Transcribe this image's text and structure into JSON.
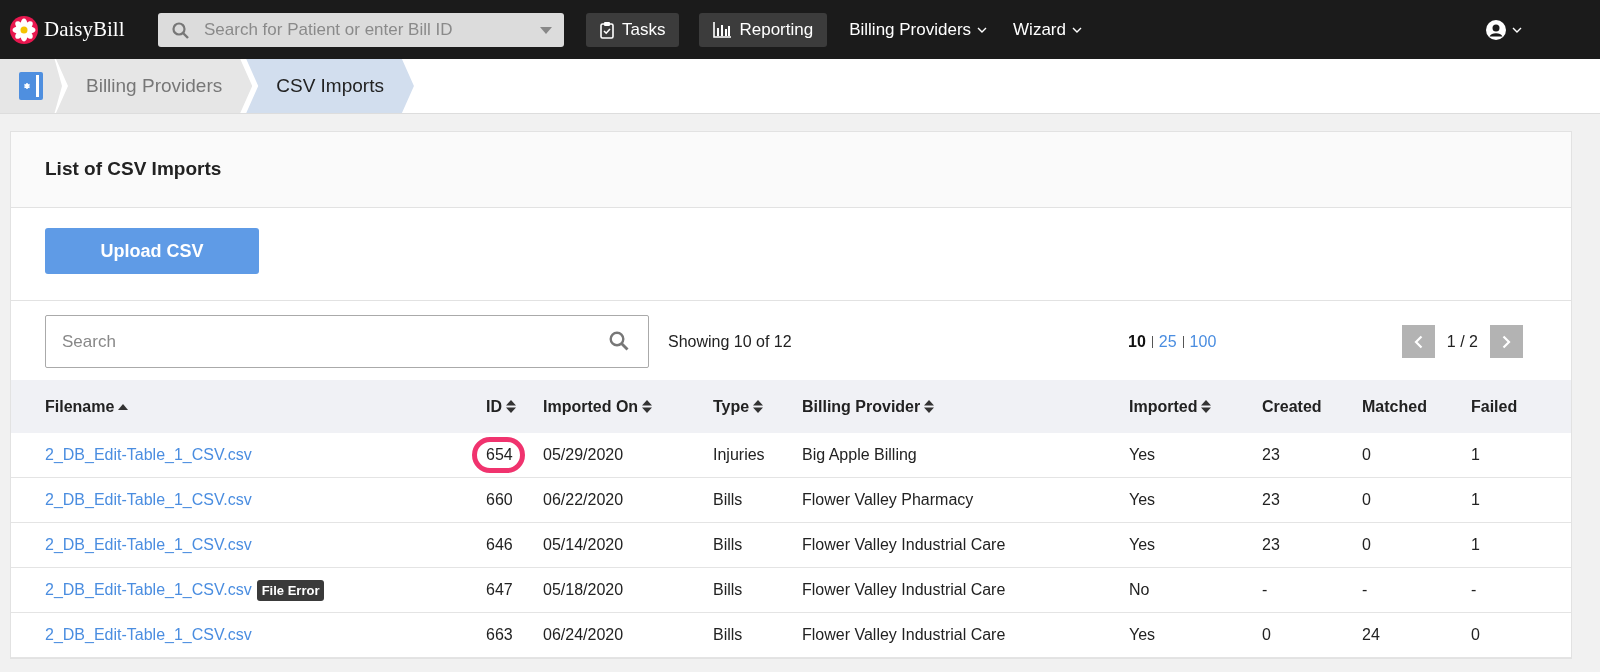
{
  "nav": {
    "brand": "DaisyBill",
    "search_placeholder": "Search for Patient or enter Bill ID",
    "buttons": [
      {
        "label": "Tasks",
        "kind": "tasks"
      },
      {
        "label": "Reporting",
        "kind": "reporting"
      }
    ],
    "menus": [
      "Billing Providers",
      "Wizard"
    ]
  },
  "breadcrumbs": [
    {
      "label": "Billing Providers",
      "selected": false
    },
    {
      "label": "CSV Imports",
      "selected": true
    }
  ],
  "card": {
    "title": "List of CSV Imports",
    "upload_button": "Upload CSV",
    "search_placeholder": "Search",
    "showing": "Showing 10 of 12",
    "page_sizes": [
      {
        "label": "10",
        "selected": true
      },
      {
        "label": "25",
        "selected": false
      },
      {
        "label": "100",
        "selected": false
      }
    ],
    "page": "1 / 2"
  },
  "table": {
    "columns": [
      {
        "label": "Filename",
        "sortable": true,
        "sorted": true
      },
      {
        "label": "ID",
        "sortable": true,
        "sorted": false
      },
      {
        "label": "Imported On",
        "sortable": true,
        "sorted": false
      },
      {
        "label": "Type",
        "sortable": true,
        "sorted": false
      },
      {
        "label": "Billing Provider",
        "sortable": true,
        "sorted": false
      },
      {
        "label": "Imported",
        "sortable": true,
        "sorted": false
      },
      {
        "label": "Created",
        "sortable": false,
        "sorted": false
      },
      {
        "label": "Matched",
        "sortable": false,
        "sorted": false
      },
      {
        "label": "Failed",
        "sortable": false,
        "sorted": false
      }
    ],
    "rows": [
      {
        "filename": "2_DB_Edit-Table_1_CSV.csv",
        "id": "654",
        "highlighted": true,
        "imported_on": "05/29/2020",
        "type": "Injuries",
        "provider": "Big Apple Billing",
        "imported": "Yes",
        "created": "23",
        "matched": "0",
        "failed": "1"
      },
      {
        "filename": "2_DB_Edit-Table_1_CSV.csv",
        "id": "660",
        "highlighted": false,
        "imported_on": "06/22/2020",
        "type": "Bills",
        "provider": "Flower Valley Pharmacy",
        "imported": "Yes",
        "created": "23",
        "matched": "0",
        "failed": "1"
      },
      {
        "filename": "2_DB_Edit-Table_1_CSV.csv",
        "id": "646",
        "highlighted": false,
        "imported_on": "05/14/2020",
        "type": "Bills",
        "provider": "Flower Valley Industrial Care",
        "imported": "Yes",
        "created": "23",
        "matched": "0",
        "failed": "1"
      },
      {
        "filename": "2_DB_Edit-Table_1_CSV.csv",
        "badge": "File Error",
        "id": "647",
        "highlighted": false,
        "imported_on": "05/18/2020",
        "type": "Bills",
        "provider": "Flower Valley Industrial Care",
        "imported": "No",
        "created": "-",
        "matched": "-",
        "failed": "-"
      },
      {
        "filename": "2_DB_Edit-Table_1_CSV.csv",
        "id": "663",
        "highlighted": false,
        "imported_on": "06/24/2020",
        "type": "Bills",
        "provider": "Flower Valley Industrial Care",
        "imported": "Yes",
        "created": "0",
        "matched": "24",
        "failed": "0"
      }
    ]
  }
}
